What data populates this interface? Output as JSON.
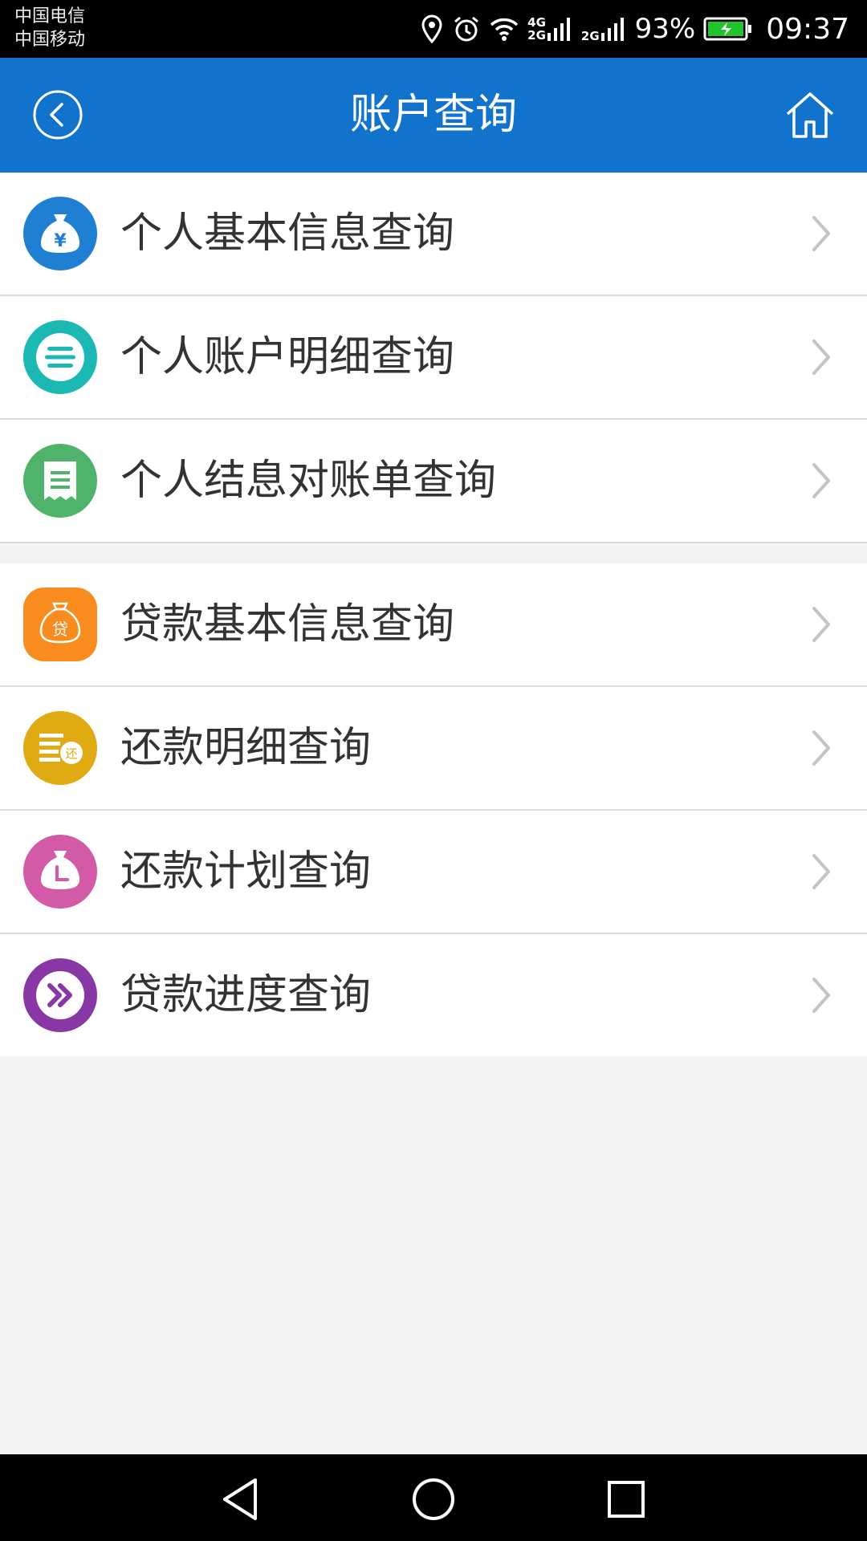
{
  "status_bar": {
    "carrier_1": "中国电信",
    "carrier_2": "中国移动",
    "net_1_top": "4G",
    "net_1_bottom": "2G",
    "net_2": "2G",
    "battery_percent": "93%",
    "time": "09:37"
  },
  "header": {
    "title": "账户查询",
    "back_icon": "chevron-left-circle-icon",
    "home_icon": "home-icon",
    "color": "#1173cc"
  },
  "menu": {
    "personal": [
      {
        "label": "个人基本信息查询",
        "icon": "money-bag-yen-icon",
        "color": "#1e7fd3",
        "glyph": "¥"
      },
      {
        "label": "个人账户明细查询",
        "icon": "list-lines-icon",
        "color": "#1cb8b4"
      },
      {
        "label": "个人结息对账单查询",
        "icon": "receipt-icon",
        "color": "#4fb36b"
      }
    ],
    "loan": [
      {
        "label": "贷款基本信息查询",
        "icon": "loan-bag-icon",
        "color": "#f98c1e",
        "glyph": "贷"
      },
      {
        "label": "还款明细查询",
        "icon": "repay-list-icon",
        "color": "#e0aa12",
        "glyph": "还"
      },
      {
        "label": "还款计划查询",
        "icon": "money-bag-clock-icon",
        "color": "#d25aa6"
      },
      {
        "label": "贷款进度查询",
        "icon": "double-chevron-right-icon",
        "color": "#8a37a6"
      }
    ]
  },
  "nav_bar": {
    "back": "triangle-back-icon",
    "home": "circle-home-icon",
    "recents": "square-recents-icon"
  }
}
